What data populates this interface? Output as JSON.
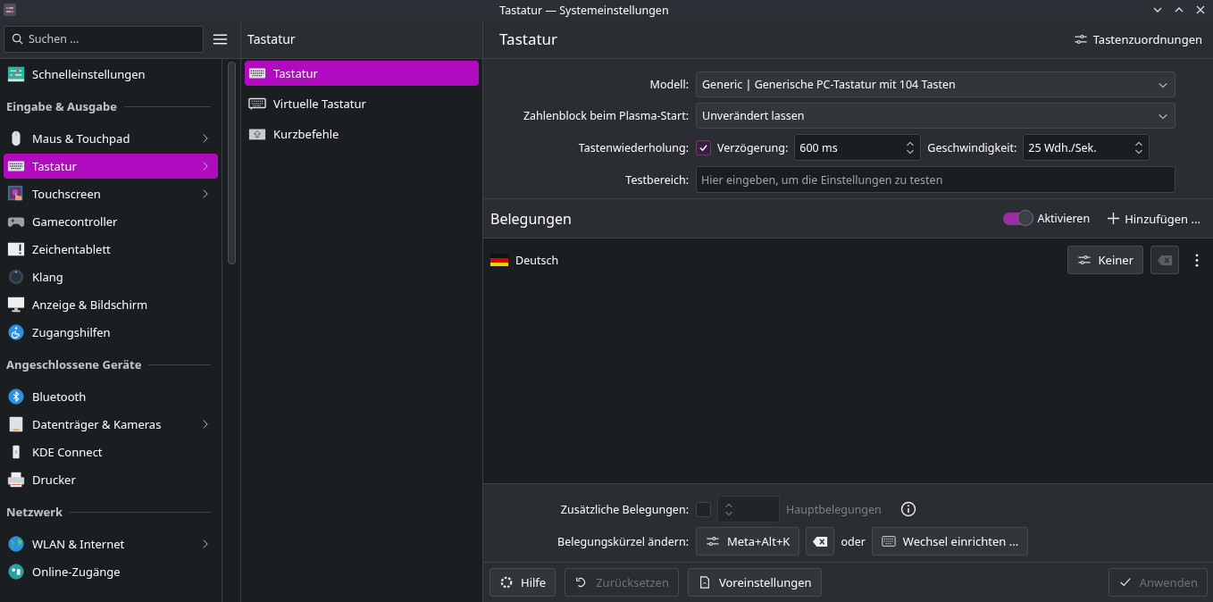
{
  "window": {
    "title": "Tastatur — Systemeinstellungen"
  },
  "sidebar": {
    "search": {
      "placeholder": "Suchen ..."
    },
    "items": [
      {
        "kind": "item",
        "label": "Schnelleinstellungen",
        "has_children": false,
        "selected": false
      },
      {
        "kind": "header",
        "label": "Eingabe & Ausgabe"
      },
      {
        "kind": "item",
        "label": "Maus & Touchpad",
        "has_children": true,
        "selected": false
      },
      {
        "kind": "item",
        "label": "Tastatur",
        "has_children": true,
        "selected": true
      },
      {
        "kind": "item",
        "label": "Touchscreen",
        "has_children": true,
        "selected": false
      },
      {
        "kind": "item",
        "label": "Gamecontroller",
        "has_children": false,
        "selected": false
      },
      {
        "kind": "item",
        "label": "Zeichentablett",
        "has_children": false,
        "selected": false
      },
      {
        "kind": "item",
        "label": "Klang",
        "has_children": false,
        "selected": false
      },
      {
        "kind": "item",
        "label": "Anzeige & Bildschirm",
        "has_children": false,
        "selected": false
      },
      {
        "kind": "item",
        "label": "Zugangshilfen",
        "has_children": false,
        "selected": false
      },
      {
        "kind": "header",
        "label": "Angeschlossene Geräte"
      },
      {
        "kind": "item",
        "label": "Bluetooth",
        "has_children": false,
        "selected": false
      },
      {
        "kind": "item",
        "label": "Datenträger & Kameras",
        "has_children": true,
        "selected": false
      },
      {
        "kind": "item",
        "label": "KDE Connect",
        "has_children": false,
        "selected": false
      },
      {
        "kind": "item",
        "label": "Drucker",
        "has_children": false,
        "selected": false
      },
      {
        "kind": "header",
        "label": "Netzwerk"
      },
      {
        "kind": "item",
        "label": "WLAN & Internet",
        "has_children": true,
        "selected": false
      },
      {
        "kind": "item",
        "label": "Online-Zugänge",
        "has_children": false,
        "selected": false
      }
    ]
  },
  "subpanel": {
    "title": "Tastatur",
    "items": [
      {
        "label": "Tastatur",
        "selected": true
      },
      {
        "label": "Virtuelle Tastatur",
        "selected": false
      },
      {
        "label": "Kurzbefehle",
        "selected": false
      }
    ]
  },
  "main": {
    "title": "Tastatur",
    "mappings_button": "Tastenzuordnungen",
    "form": [
      {
        "kind": "combo",
        "label": "Modell:",
        "value": "Generic | Generische PC-Tastatur mit 104 Tasten"
      },
      {
        "kind": "combo",
        "label": "Zahlenblock beim Plasma-Start:",
        "value": "Unverändert lassen"
      },
      {
        "kind": "repeat",
        "label": "Tastenwiederholung:",
        "checked": true,
        "delay_label": "Verzögerung:",
        "delay": "600 ms",
        "rate_label": "Geschwindigkeit:",
        "rate": "25 Wdh./Sek."
      },
      {
        "kind": "text",
        "label": "Testbereich:",
        "placeholder": "Hier eingeben, um die Einstellungen zu testen"
      }
    ],
    "layouts": {
      "title": "Belegungen",
      "toggle": {
        "label": "Aktivieren",
        "on": true
      },
      "add_button": "Hinzufügen ...",
      "rows": [
        {
          "name": "Deutsch",
          "shortcut": "Keiner"
        }
      ]
    },
    "extra": {
      "label": "Zusätzliche Belegungen:",
      "checked": false,
      "disabled": true,
      "suffix": "Hauptbelegungen"
    },
    "shortcut": {
      "label": "Belegungskürzel ändern:",
      "value": "Meta+Alt+K",
      "or": "oder",
      "switch_button": "Wechsel einrichten ..."
    },
    "buttons": [
      {
        "kind": "help",
        "label": "Hilfe",
        "disabled": false
      },
      {
        "kind": "reset",
        "label": "Zurücksetzen",
        "disabled": true
      },
      {
        "kind": "defaults",
        "label": "Voreinstellungen",
        "disabled": false
      },
      {
        "kind": "apply",
        "label": "Anwenden",
        "disabled": true
      }
    ]
  }
}
